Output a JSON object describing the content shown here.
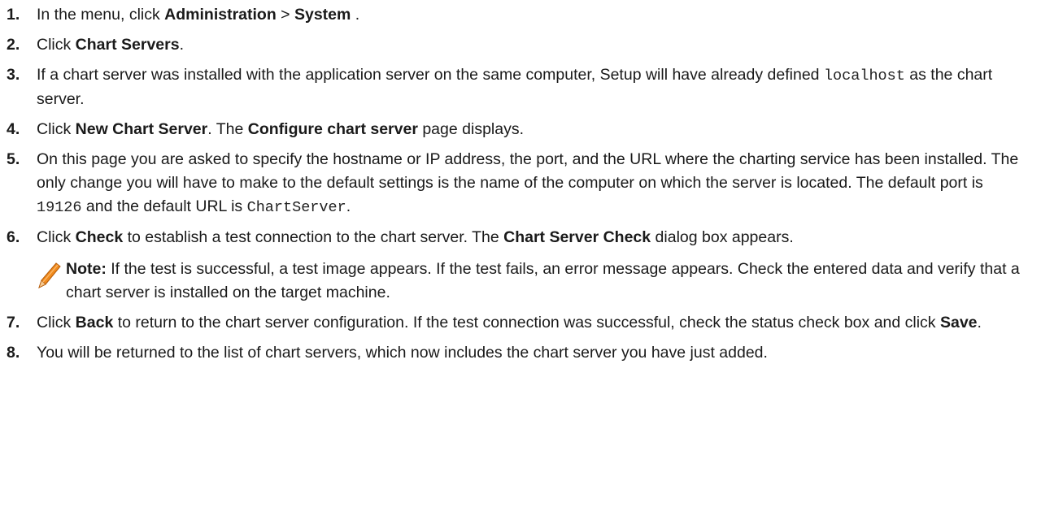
{
  "steps": [
    {
      "num": "1.",
      "parts": [
        {
          "t": "In the menu, click "
        },
        {
          "b": "Administration"
        },
        {
          "t": " > "
        },
        {
          "b": "System"
        },
        {
          "t": " ."
        }
      ]
    },
    {
      "num": "2.",
      "parts": [
        {
          "t": "Click "
        },
        {
          "b": "Chart Servers"
        },
        {
          "t": "."
        }
      ]
    },
    {
      "num": "3.",
      "parts": [
        {
          "t": "If a chart server was installed with the application server on the same computer, Setup will have already defined "
        },
        {
          "c": "localhost"
        },
        {
          "t": " as the chart server."
        }
      ]
    },
    {
      "num": "4.",
      "parts": [
        {
          "t": "Click "
        },
        {
          "b": "New Chart Server"
        },
        {
          "t": ". The "
        },
        {
          "b": "Configure chart server"
        },
        {
          "t": " page displays."
        }
      ]
    },
    {
      "num": "5.",
      "parts": [
        {
          "t": "On this page you are asked to specify the hostname or IP address, the port, and the URL where the charting service has been installed. The only change you will have to make to the default settings is the name of the computer on which the server is located. The default port is "
        },
        {
          "c": "19126"
        },
        {
          "t": " and the default URL is "
        },
        {
          "c": "ChartServer"
        },
        {
          "t": "."
        }
      ]
    },
    {
      "num": "6.",
      "parts": [
        {
          "t": "Click "
        },
        {
          "b": "Check"
        },
        {
          "t": " to establish a test connection to the chart server. The "
        },
        {
          "b": "Chart Server Check"
        },
        {
          "t": " dialog box appears."
        }
      ],
      "note": {
        "label": "Note:",
        "text": " If the test is successful, a test image appears. If the test fails, an error message appears. Check the entered data and verify that a chart server is installed on the target machine."
      }
    },
    {
      "num": "7.",
      "parts": [
        {
          "t": "Click "
        },
        {
          "b": "Back"
        },
        {
          "t": " to return to the chart server configuration. If the test connection was successful, check the status check box and click "
        },
        {
          "b": "Save"
        },
        {
          "t": "."
        }
      ]
    },
    {
      "num": "8.",
      "parts": [
        {
          "t": "You will be returned to the list of chart servers, which now includes the chart server you have just added."
        }
      ]
    }
  ],
  "colors": {
    "pencil_body": "#f08a1c",
    "pencil_dark": "#b35a08"
  }
}
